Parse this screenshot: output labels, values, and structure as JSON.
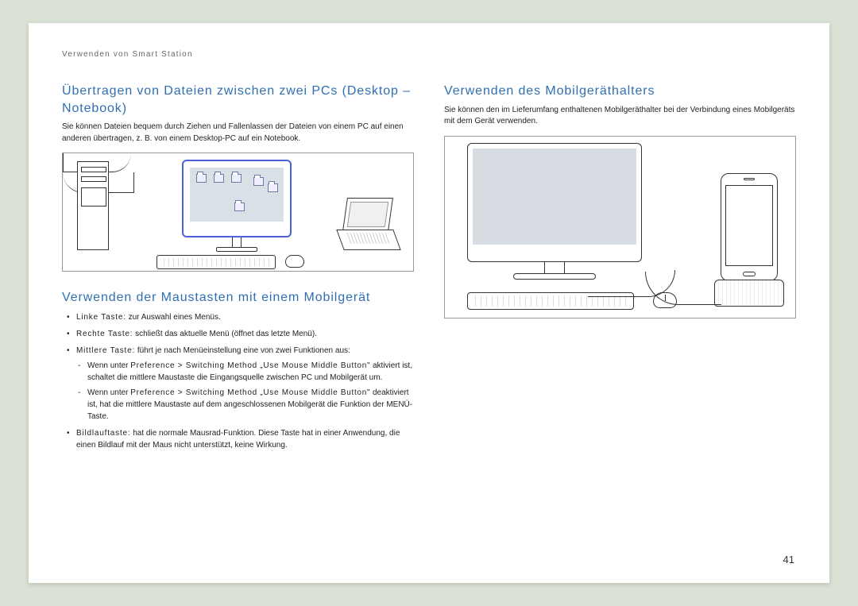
{
  "header": {
    "section_label": "Verwenden von Smart Station"
  },
  "page_number": "41",
  "left": {
    "h1_title": "Übertragen von Dateien zwischen zwei PCs (Desktop – Notebook)",
    "h1_body": "Sie können Dateien bequem durch Ziehen und Fallenlassen der Dateien von einem PC auf einen anderen übertragen, z. B. von einem Desktop-PC auf ein Notebook.",
    "h2_title": "Verwenden der Maustasten mit einem Mobilgerät",
    "b1_term": "Linke Taste:",
    "b1_rest": " zur Auswahl eines Menüs.",
    "b2_term": "Rechte Taste:",
    "b2_rest": " schließt das aktuelle Menü (öffnet das letzte Menü).",
    "b3_term": "Mittlere Taste:",
    "b3_rest": " führt je nach Menüeinstellung eine von zwei Funktionen aus:",
    "b3_s1_pre": "Wenn unter ",
    "b3_s1_emph": "Preference > Switching Method „Use Mouse Middle Button\"",
    "b3_s1_post": " aktiviert ist, schaltet die mittlere Maustaste die Eingangsquelle zwischen PC und Mobilgerät um.",
    "b3_s2_pre": "Wenn unter ",
    "b3_s2_emph": "Preference > Switching Method „Use Mouse Middle Button\"",
    "b3_s2_post": " deaktiviert ist, hat die mittlere Maustaste auf dem angeschlossenen Mobilgerät die Funktion der MENÜ-Taste.",
    "b4_term": "Bildlauftaste:",
    "b4_rest": " hat die normale Mausrad-Funktion. Diese Taste hat in einer Anwendung, die einen Bildlauf mit der Maus nicht unterstützt, keine Wirkung."
  },
  "right": {
    "h1_title": "Verwenden des Mobilgeräthalters",
    "h1_body": "Sie können den im Lieferumfang enthaltenen Mobilgeräthalter bei der Verbindung eines Mobilgeräts mit dem Gerät verwenden."
  }
}
